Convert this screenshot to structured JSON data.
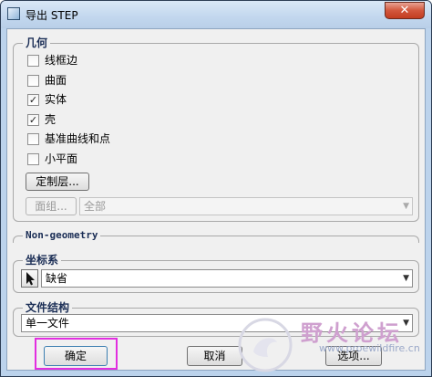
{
  "window": {
    "title": "导出 STEP",
    "close_symbol": "✕"
  },
  "geometry": {
    "legend": "几何",
    "checkboxes": [
      {
        "label": "线框边",
        "checked": false
      },
      {
        "label": "曲面",
        "checked": false
      },
      {
        "label": "实体",
        "checked": true
      },
      {
        "label": "壳",
        "checked": true
      },
      {
        "label": "基准曲线和点",
        "checked": false
      },
      {
        "label": "小平面",
        "checked": false
      }
    ],
    "custom_layer_button": "定制层...",
    "face_group_button": "面组...",
    "face_group_combo": "全部"
  },
  "non_geometry": {
    "legend": "Non-geometry"
  },
  "coordinate_system": {
    "legend": "坐标系",
    "value": "缺省"
  },
  "file_structure": {
    "legend": "文件结构",
    "value": "单一文件"
  },
  "buttons": {
    "ok": "确定",
    "cancel": "取消",
    "options": "选项..."
  },
  "watermark": {
    "text": "野火论坛",
    "url": "www.proewildfire.cn"
  },
  "colors": {
    "highlight": "#e22ee0",
    "legend_text": "#1a2d55"
  }
}
